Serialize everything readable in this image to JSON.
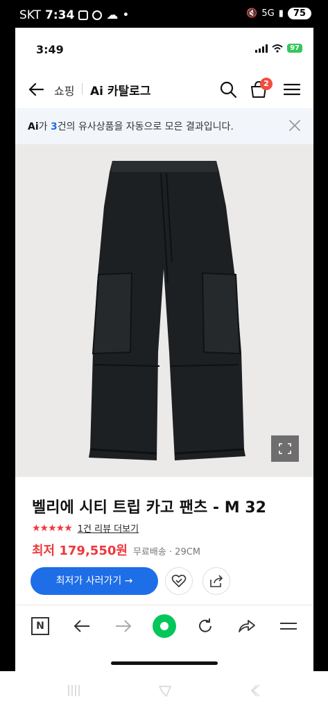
{
  "outer_status": {
    "carrier": "SKT",
    "time": "7:34",
    "battery": "75"
  },
  "inner_status": {
    "time": "3:49",
    "battery": "97"
  },
  "nav": {
    "shopping": "쇼핑",
    "catalog_title": "Ai 카탈로그",
    "cart_count": "2"
  },
  "ai_banner": {
    "ai": "Ai",
    "prefix": "가 ",
    "count": "3",
    "suffix": "건의 유사상품을 자동으로 모은 결과입니다."
  },
  "product": {
    "title": "벨리에 시티 트립 카고 팬츠 - M 32",
    "stars": "★★★★★",
    "rating_fraction": 1.0,
    "review_link": "1건 리뷰 더보기",
    "price": "최저 179,550원",
    "shipping": "무료배송 · 29CM",
    "cta": "최저가 사러가기 →"
  },
  "colors": {
    "accent": "#1e6ee8",
    "price_red": "#f0383b",
    "naver_green": "#03c75a"
  },
  "toolbar": {
    "n_label": "N"
  }
}
